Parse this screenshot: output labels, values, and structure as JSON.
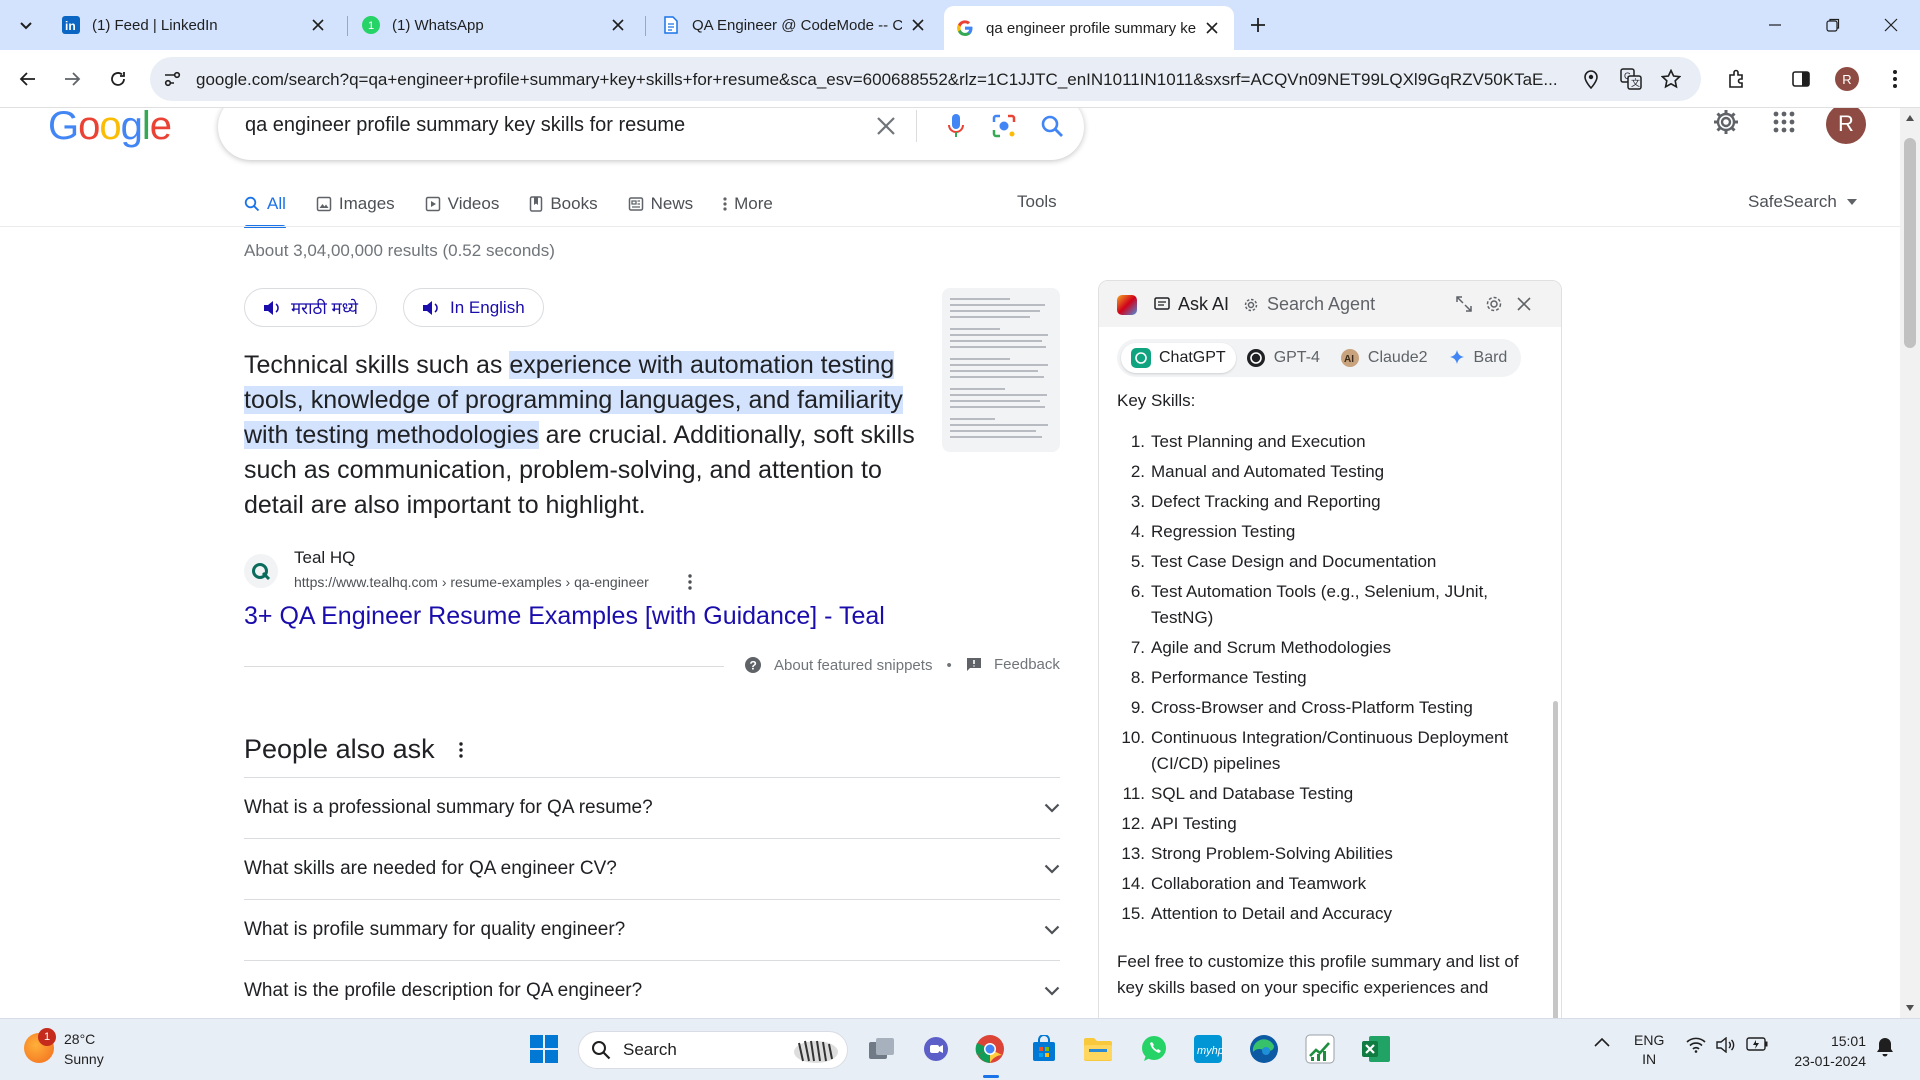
{
  "browser": {
    "tabs": [
      {
        "title": "(1) Feed | LinkedIn",
        "icon": "linkedin-icon"
      },
      {
        "title": "(1) WhatsApp",
        "icon": "whatsapp-icon"
      },
      {
        "title": "QA Engineer @ CodeMode -- C",
        "icon": "document-icon"
      },
      {
        "title": "qa engineer profile summary ke",
        "icon": "google-icon"
      }
    ],
    "url": "google.com/search?q=qa+engineer+profile+summary+key+skills+for+resume&sca_esv=600688552&rlz=1C1JJTC_enIN1011IN1011&sxsrf=ACQVn09NET99LQXl9GqRZV50KTaE...",
    "profile_initial": "R"
  },
  "google": {
    "logo": "Google",
    "query": "qa engineer profile summary key skills for resume",
    "nav_tabs": [
      {
        "label": "All",
        "icon": "search-icon"
      },
      {
        "label": "Images",
        "icon": "image-icon"
      },
      {
        "label": "Videos",
        "icon": "video-icon"
      },
      {
        "label": "Books",
        "icon": "book-icon"
      },
      {
        "label": "News",
        "icon": "news-icon"
      },
      {
        "label": "More",
        "icon": "more-vert-icon"
      }
    ],
    "tools_label": "Tools",
    "safesearch_label": "SafeSearch",
    "result_stats": "About 3,04,00,000 results (0.52 seconds)",
    "lang_pills": [
      "मराठी मध्ये",
      "In English"
    ],
    "snippet": {
      "pre": "Technical skills such as ",
      "highlight": "experience with automation testing tools, knowledge of programming languages, and familiarity with testing methodologies",
      "post": " are crucial. Additionally, soft skills such as communication, problem-solving, and attention to detail are also important to highlight."
    },
    "source": {
      "name": "Teal HQ",
      "url": "https://www.tealhq.com › resume-examples › qa-engineer",
      "title": "3+ QA Engineer Resume Examples [with Guidance] - Teal"
    },
    "about_snippets": "About featured snippets",
    "separator": "•",
    "feedback": "Feedback",
    "paa_title": "People also ask",
    "paa_questions": [
      "What is a professional summary for QA resume?",
      "What skills are needed for QA engineer CV?",
      "What is profile summary for quality engineer?",
      "What is the profile description for QA engineer?"
    ],
    "profile_initial": "R"
  },
  "ai_panel": {
    "tab_ask": "Ask AI",
    "tab_agent": "Search Agent",
    "models": [
      "ChatGPT",
      "GPT-4",
      "Claude2",
      "Bard"
    ],
    "heading": "Key Skills:",
    "skills": [
      "Test Planning and Execution",
      "Manual and Automated Testing",
      "Defect Tracking and Reporting",
      "Regression Testing",
      "Test Case Design and Documentation",
      "Test Automation Tools (e.g., Selenium, JUnit, TestNG)",
      "Agile and Scrum Methodologies",
      "Performance Testing",
      "Cross-Browser and Cross-Platform Testing",
      "Continuous Integration/Continuous Deployment (CI/CD) pipelines",
      "SQL and Database Testing",
      "API Testing",
      "Strong Problem-Solving Abilities",
      "Collaboration and Teamwork",
      "Attention to Detail and Accuracy"
    ],
    "footer": "Feel free to customize this profile summary and list of key skills based on your specific experiences and"
  },
  "taskbar": {
    "weather_temp": "28°C",
    "weather_desc": "Sunny",
    "weather_badge": "1",
    "search_label": "Search",
    "lang_line1": "ENG",
    "lang_line2": "IN",
    "time": "15:01",
    "date": "23-01-2024"
  },
  "colors": {
    "accent": "#1a73e8",
    "link": "#1a0dab",
    "highlight": "#d3e3fd",
    "tabbar": "#d3e3fd"
  }
}
